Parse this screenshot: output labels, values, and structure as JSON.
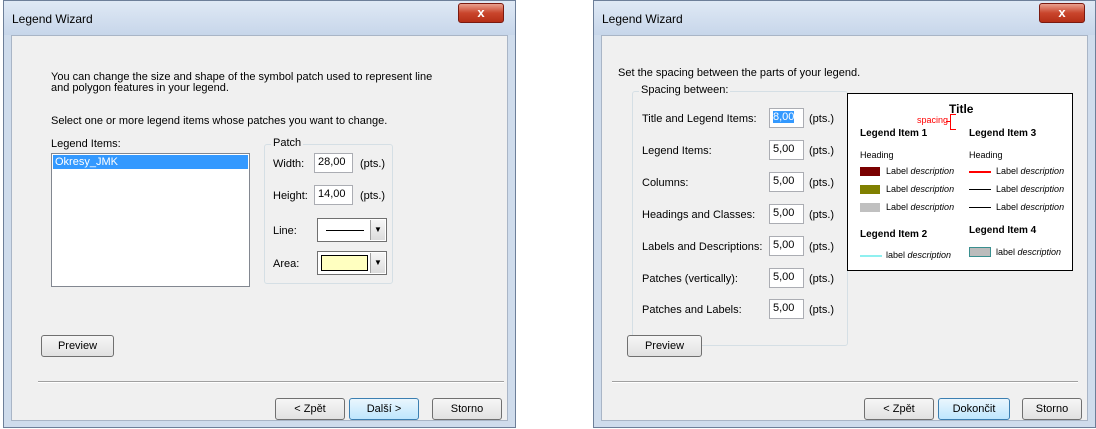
{
  "dialog1": {
    "title": "Legend Wizard",
    "close": "x",
    "intro": "You can change the size and shape of the symbol patch used to represent line and polygon features in your legend.",
    "instruction": "Select one or more legend items whose patches you want to change.",
    "list_label": "Legend Items:",
    "list_items": [
      "Okresy_JMK"
    ],
    "patch_group": "Patch",
    "width_label": "Width:",
    "width_value": "28,00",
    "height_label": "Height:",
    "height_value": "14,00",
    "pts": "(pts.)",
    "line_label": "Line:",
    "area_label": "Area:",
    "area_color": "#ffffc0",
    "preview_button": "Preview",
    "back_button": "< Zpět",
    "next_button": "Další >",
    "cancel_button": "Storno"
  },
  "dialog2": {
    "title": "Legend Wizard",
    "close": "x",
    "intro": "Set the spacing between the parts of your legend.",
    "group": "Spacing between:",
    "pts": "(pts.)",
    "rows": [
      {
        "label": "Title and Legend Items:",
        "value": "8,00"
      },
      {
        "label": "Legend Items:",
        "value": "5,00"
      },
      {
        "label": "Columns:",
        "value": "5,00"
      },
      {
        "label": "Headings and Classes:",
        "value": "5,00"
      },
      {
        "label": "Labels and Descriptions:",
        "value": "5,00"
      },
      {
        "label": "Patches (vertically):",
        "value": "5,00"
      },
      {
        "label": "Patches and Labels:",
        "value": "5,00"
      }
    ],
    "preview_button": "Preview",
    "back_button": "< Zpět",
    "finish_button": "Dokončit",
    "cancel_button": "Storno",
    "legend_preview": {
      "title": "Title",
      "spacing": "spacing",
      "item1": "Legend Item 1",
      "item2": "Legend Item 2",
      "item3": "Legend Item 3",
      "item4": "Legend Item 4",
      "heading": "Heading",
      "label_upper": "Label",
      "label_lower": "label",
      "description": "description",
      "colors": {
        "dark_red": "#7a0000",
        "olive": "#808000",
        "gray": "#c0c0c0",
        "red": "#ff0000",
        "cyan": "#8ff0f0",
        "gray_patch": "#bcbcbc"
      }
    }
  }
}
